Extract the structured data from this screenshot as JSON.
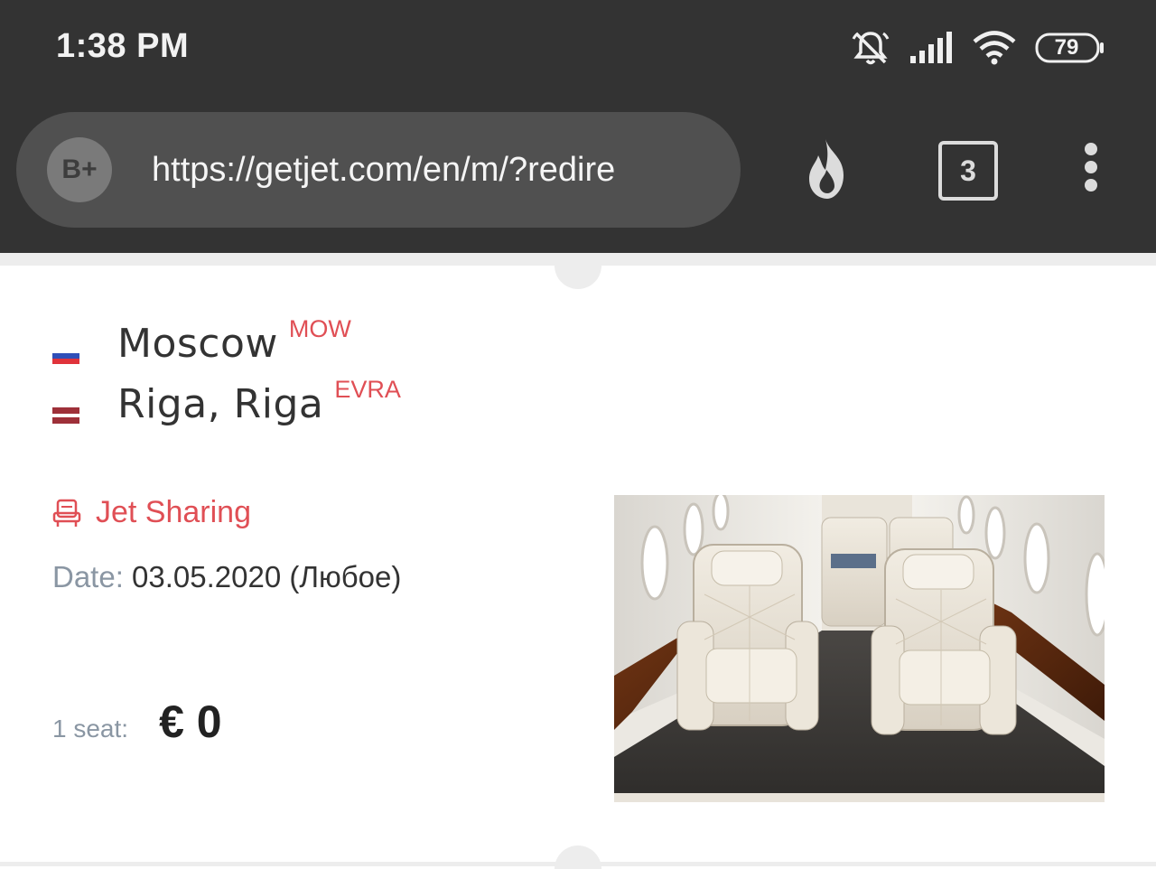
{
  "status_bar": {
    "time": "1:38 PM",
    "battery": "79",
    "icons": [
      "mute-icon",
      "signal-icon",
      "wifi-icon",
      "battery-icon"
    ]
  },
  "browser": {
    "extension_label": "B+",
    "url": "https://getjet.com/en/m/?redire",
    "tab_count": "3",
    "icons": [
      "fire-icon",
      "menu-dots-icon"
    ]
  },
  "flight": {
    "from": {
      "city": "Moscow",
      "code": "MOW"
    },
    "to": {
      "city": "Riga, Riga",
      "code": "EVRA"
    },
    "service": "Jet Sharing",
    "date_label": "Date:",
    "date_value": "03.05.2020 (Любое)",
    "seat_label": "1 seat:",
    "price": "€ 0"
  },
  "colors": {
    "accent": "#e04f55",
    "status_bar_bg": "#333333",
    "muted_text": "#8a96a3"
  }
}
